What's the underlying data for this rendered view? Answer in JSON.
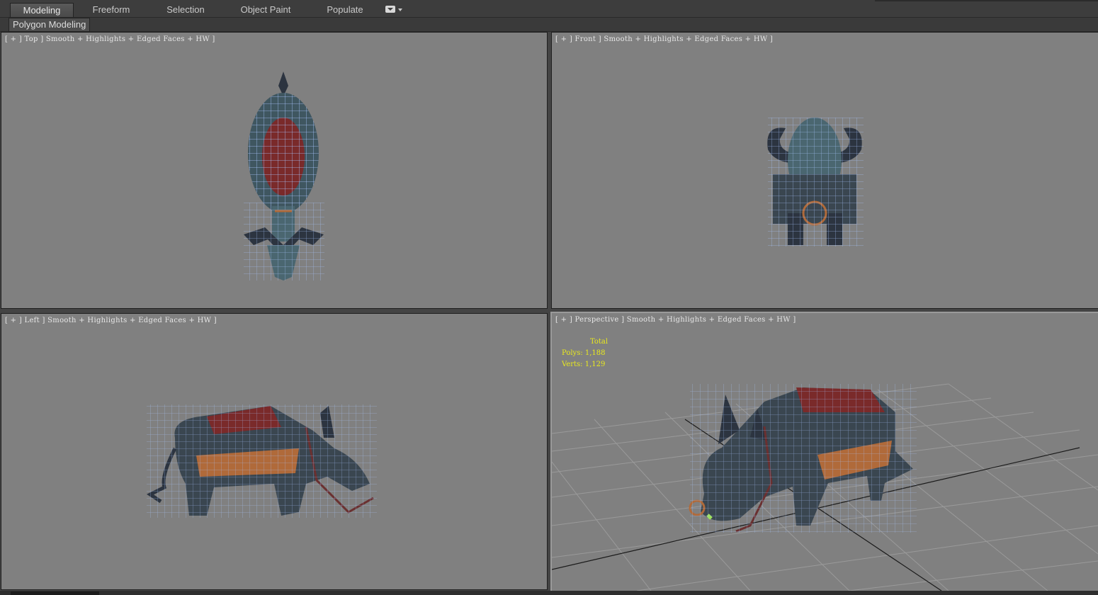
{
  "tabs": [
    {
      "label": "Modeling",
      "active": true
    },
    {
      "label": "Freeform",
      "active": false
    },
    {
      "label": "Selection",
      "active": false
    },
    {
      "label": "Object Paint",
      "active": false
    },
    {
      "label": "Populate",
      "active": false
    }
  ],
  "ribbon": {
    "panel_label": "Polygon Modeling"
  },
  "viewports": {
    "top": {
      "label": "[ + ] Top ] Smooth + Highlights + Edged Faces + HW ]"
    },
    "front": {
      "label": "[ + ] Front ] Smooth + Highlights + Edged Faces + HW ]"
    },
    "left": {
      "label": "[ + ] Left ] Smooth + Highlights + Edged Faces + HW ]"
    },
    "perspective": {
      "label": "[ + ] Perspective ] Smooth + Highlights + Edged Faces + HW ]"
    }
  },
  "stats": {
    "header": "Total",
    "polys_label": "Polys:",
    "polys_value": "1,188",
    "verts_label": "Verts:",
    "verts_value": "1,129"
  },
  "colors": {
    "viewport_bg": "#808080",
    "wire": "#aac8ff",
    "body_dark": "#2c3440",
    "body_teal": "#4a6670",
    "saddle_red": "#7a2a2a",
    "fringe": "#b06a3a",
    "stats_yellow": "#e8e81e"
  },
  "icons": [
    "viewport-dropdown-icon",
    "chevron-down-icon"
  ]
}
